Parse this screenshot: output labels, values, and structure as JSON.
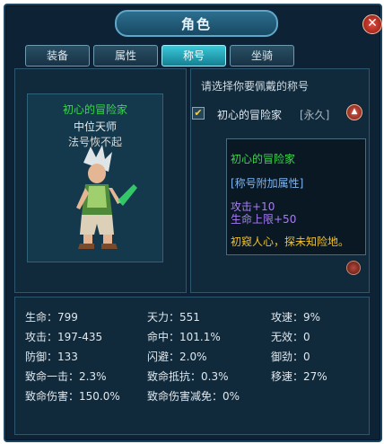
{
  "window": {
    "title": "角色",
    "close_symbol": "✕"
  },
  "tabs": [
    {
      "label": "装备",
      "active": false
    },
    {
      "label": "属性",
      "active": false
    },
    {
      "label": "称号",
      "active": true
    },
    {
      "label": "坐骑",
      "active": false
    }
  ],
  "character": {
    "title_name": "初心的冒险家",
    "rank": "中位天师",
    "note": "法号恢不起"
  },
  "titles_panel": {
    "instruction": "请选择你要佩戴的称号",
    "items": [
      {
        "checked": true,
        "label": "初心的冒险家",
        "duration": "[永久]"
      }
    ]
  },
  "tooltip": {
    "name": "初心的冒险家",
    "heading": "[称号附加属性]",
    "attributes": [
      "攻击+10",
      "生命上限+50"
    ],
    "description": "初窥人心，探未知险地。"
  },
  "stats": [
    {
      "label": "生命：799"
    },
    {
      "label": "攻击：197-435"
    },
    {
      "label": "防御：133"
    },
    {
      "label": "致命一击：2.3%"
    },
    {
      "label": "致命伤害：150.0%"
    },
    {
      "label": "天力：551"
    },
    {
      "label": "命中：101.1%"
    },
    {
      "label": "闪避：2.0%"
    },
    {
      "label": "致命抵抗：0.3%"
    },
    {
      "label": "致命伤害减免：0%"
    },
    {
      "label": "攻速：9%"
    },
    {
      "label": "无效：0"
    },
    {
      "label": "御劲：0"
    },
    {
      "label": "移速：27%"
    }
  ],
  "colors": {
    "accent_green": "#39d94a",
    "tooltip_blue": "#7db6f2",
    "tooltip_purple": "#a77ef2",
    "tooltip_yellow": "#f2c12c"
  }
}
